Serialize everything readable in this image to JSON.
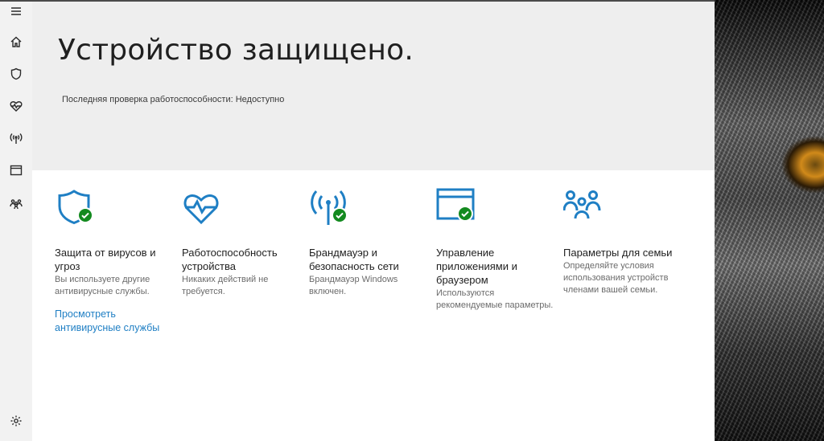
{
  "hero": {
    "title": "Устройство защищено.",
    "subtitle": "Последняя проверка работоспособности: Недоступно"
  },
  "sidebar": {
    "items": [
      {
        "icon": "menu-icon"
      },
      {
        "icon": "home-icon"
      },
      {
        "icon": "shield-icon"
      },
      {
        "icon": "heart-pulse-icon"
      },
      {
        "icon": "wireless-icon"
      },
      {
        "icon": "browser-window-icon"
      },
      {
        "icon": "family-icon"
      },
      {
        "icon": "gear-icon"
      }
    ]
  },
  "tiles": [
    {
      "icon": "shield-icon",
      "title": "Защита от вирусов и угроз",
      "description": "Вы используете другие антивирусные службы.",
      "link": "Просмотреть антивирусные службы",
      "status": "ok"
    },
    {
      "icon": "heart-pulse-icon",
      "title": "Работоспособность устройства",
      "description": "Никаких действий не требуется."
    },
    {
      "icon": "wireless-icon",
      "title": "Брандмауэр и безопасность сети",
      "description": "Брандмауэр Windows включен.",
      "status": "ok"
    },
    {
      "icon": "browser-window-icon",
      "title": "Управление приложениями и браузером",
      "description": "Используются рекомендуемые параметры.",
      "status": "ok"
    },
    {
      "icon": "family-icon",
      "title": "Параметры для семьи",
      "description": "Определяйте условия использования устройств членами вашей семьи."
    }
  ],
  "colors": {
    "accent": "#1f7fc4",
    "ok_green": "#138a1f",
    "hero_bg": "#eeeeee",
    "sidebar_bg": "#f2f2f2"
  }
}
